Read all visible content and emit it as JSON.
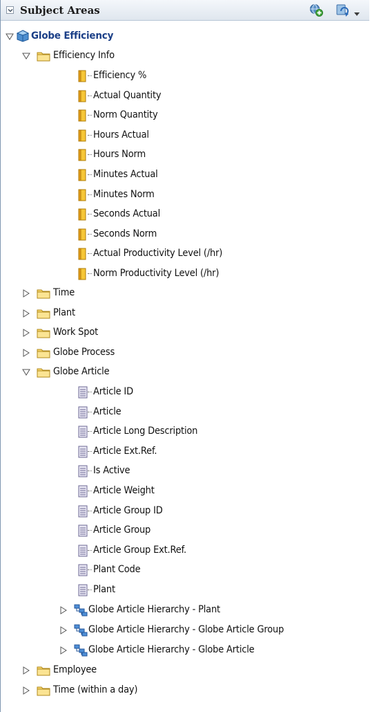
{
  "header": {
    "title": "Subject Areas",
    "add_icon": "add-subject-area-icon",
    "refresh_icon": "refresh-icon"
  },
  "tree": {
    "root": {
      "label": "Globe Efficiency",
      "icon": "subject-area-cube-icon",
      "expanded": true
    },
    "folders": [
      {
        "label": "Efficiency Info",
        "expanded": true,
        "column_icon": "measure-column-icon",
        "columns": [
          "Efficiency %",
          "Actual Quantity",
          "Norm Quantity",
          "Hours Actual",
          "Hours Norm",
          "Minutes Actual",
          "Minutes Norm",
          "Seconds Actual",
          "Seconds Norm",
          "Actual Productivity Level (/hr)",
          "Norm Productivity Level (/hr)"
        ]
      },
      {
        "label": "Time",
        "expanded": false
      },
      {
        "label": "Plant",
        "expanded": false
      },
      {
        "label": "Work Spot",
        "expanded": false
      },
      {
        "label": "Globe Process",
        "expanded": false
      },
      {
        "label": "Globe Article",
        "expanded": true,
        "column_icon": "attribute-column-icon",
        "columns": [
          "Article ID",
          "Article",
          "Article Long Description",
          "Article Ext.Ref.",
          "Is Active",
          "Article Weight",
          "Article Group ID",
          "Article Group",
          "Article Group Ext.Ref.",
          "Plant Code",
          "Plant"
        ],
        "hierarchies": [
          "Globe Article Hierarchy - Plant",
          "Globe Article Hierarchy - Globe Article Group",
          "Globe Article Hierarchy - Globe Article"
        ]
      },
      {
        "label": "Employee",
        "expanded": false
      },
      {
        "label": "Time (within a day)",
        "expanded": false
      }
    ]
  }
}
